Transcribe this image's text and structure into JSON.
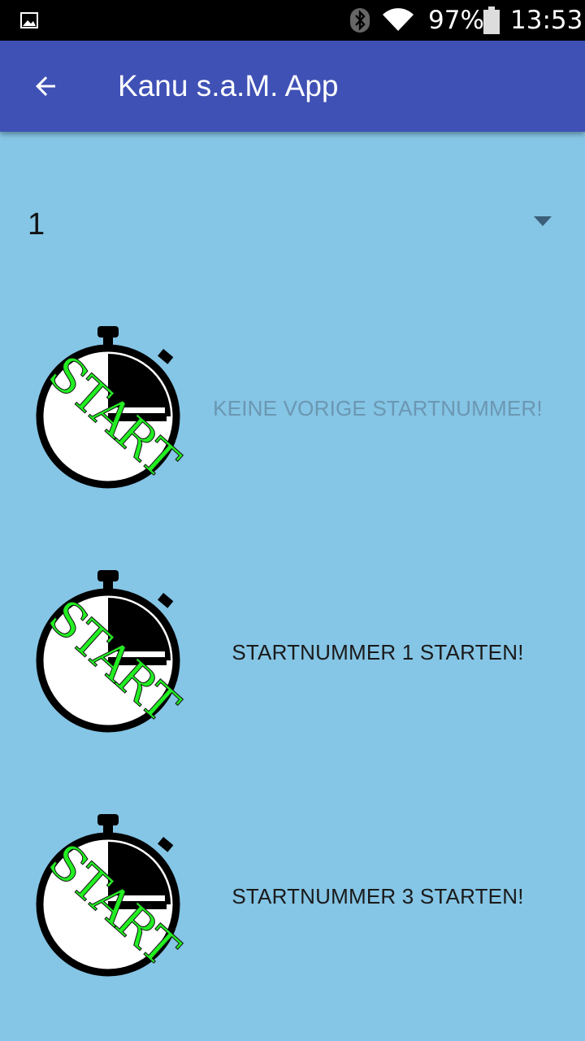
{
  "status_bar": {
    "battery_percent": "97%",
    "time": "13:53",
    "icons": [
      "gallery-icon",
      "bluetooth-icon",
      "wifi-icon",
      "battery-icon"
    ]
  },
  "app_bar": {
    "title": "Kanu s.a.M. App",
    "back_icon": "arrow-back-icon"
  },
  "spinner": {
    "selected_value": "1"
  },
  "rows": [
    {
      "button_label": "KEINE VORIGE STARTNUMMER!",
      "enabled": false,
      "icon": "start-stopwatch-icon"
    },
    {
      "button_label": "STARTNUMMER 1 STARTEN!",
      "enabled": true,
      "icon": "start-stopwatch-icon"
    },
    {
      "button_label": "STARTNUMMER 3 STARTEN!",
      "enabled": true,
      "icon": "start-stopwatch-icon"
    }
  ],
  "colors": {
    "background": "#85c5e5",
    "app_bar": "#3f51b5",
    "start_text": "#22ee22",
    "disabled_text": "#6b97b2"
  }
}
